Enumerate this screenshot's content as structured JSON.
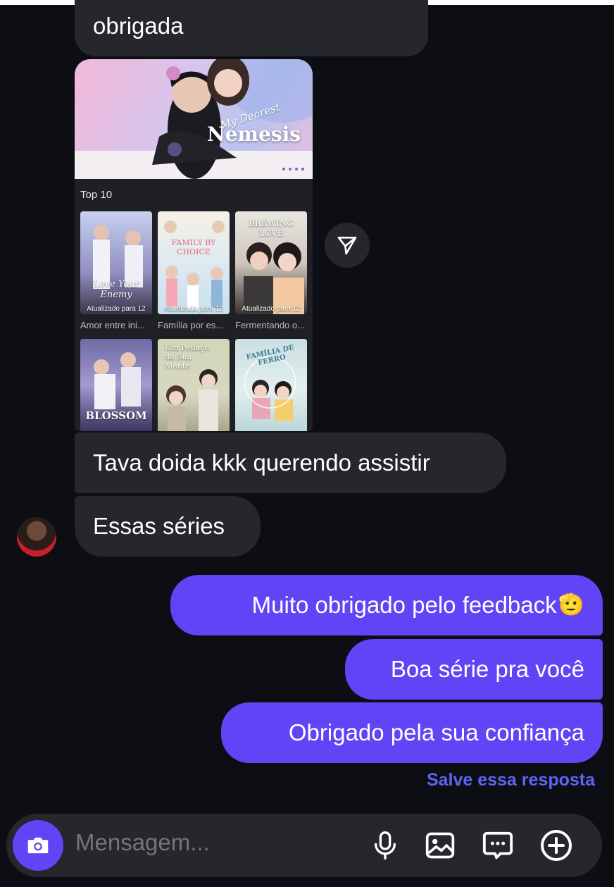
{
  "messages": {
    "first": "obrigada",
    "tava": "Tava doida kkk querendo assistir",
    "essas": "Essas séries",
    "out1": "Muito obrigado pelo feedback",
    "out1_emoji": "🫡",
    "out2": "Boa série pra você",
    "out3": "Obrigado pela sua confiança"
  },
  "shared_card": {
    "banner_subtitle": "My Dearest",
    "banner_title": "Nemesis",
    "section": "Top 10",
    "posters": [
      {
        "title": "Love Your Enemy",
        "updated": "Atualizado para 12",
        "caption": "Amor entre ini..."
      },
      {
        "title": "FAMILY BY CHOICE",
        "updated": "Atualizado para 12",
        "caption": "Família por es..."
      },
      {
        "title": "BREWING LOVE",
        "updated": "Atualizado para 12",
        "caption": "Fermentando o..."
      },
      {
        "title": "BLOSSOM"
      },
      {
        "title": "Um Pedaço da Sua Mente"
      },
      {
        "title": "FAMÍLIA DE FERRO"
      }
    ]
  },
  "save_reply": "Salve essa resposta",
  "composer": {
    "placeholder": "Mensagem...",
    "icons": [
      "camera-icon",
      "microphone-icon",
      "gallery-icon",
      "sticker-chat-icon",
      "plus-circle-icon"
    ]
  },
  "colors": {
    "background": "#0c0e13",
    "incoming_bubble": "#25272c",
    "outgoing_bubble": "#6244f6",
    "link": "#5c63f2"
  }
}
